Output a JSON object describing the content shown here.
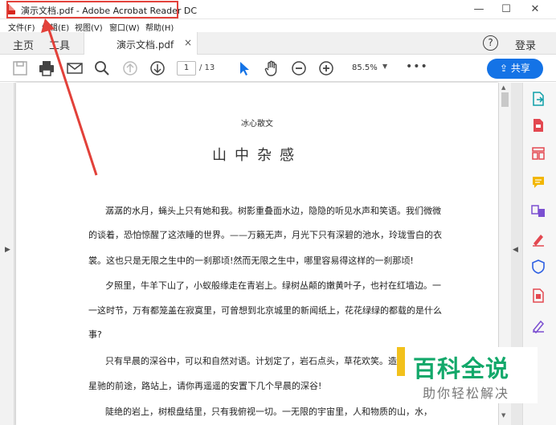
{
  "window": {
    "title": "演示文档.pdf - Adobe Acrobat Reader DC",
    "controls": [
      "—",
      "☐",
      "✕"
    ]
  },
  "menu": [
    "文件(F)",
    "编辑(E)",
    "视图(V)",
    "窗口(W)",
    "帮助(H)"
  ],
  "tabs": {
    "home": "主页",
    "tools": "工具",
    "document": "演示文档.pdf",
    "close": "×",
    "help": "?",
    "login": "登录"
  },
  "toolbar": {
    "page_current": "1",
    "page_total": "/ 13",
    "zoom": "85.5%",
    "more": "•••",
    "share": "共享"
  },
  "document": {
    "subtitle": "冰心散文",
    "title": "山中杂感",
    "lines": [
      "潺潺的水月，蝇头上只有她和我。树影重叠面水边，隐隐的听见水声和笑语。我们微微",
      "的谈着，恐怕惊醒了这浓睡的世界。——万籁无声，月光下只有深碧的池水，玲珑雪白的衣",
      "裳。这也只是无限之生中的一刹那顷!然而无限之生中，哪里容易得这样的一刹那顷!",
      "夕照里，牛羊下山了，小蚁般缘走在青岩上。绿树丛颠的嫩黄叶子，也衬在红墙边。一",
      "一这时节，万有都笼盖在寂寞里，可曾想到北京城里的新闻纸上，花花绿绿的都载的是什么",
      "事?",
      "只有早晨的深谷中，可以和自然对语。计划定了，岩石点头，草花欢笑。造物者",
      "星驰的前途，路站上，请你再遥遥的安置下几个早晨的深谷!",
      "陡绝的岩上，树根盘结里，只有我俯视一切。一无限的宇宙里，人和物质的山，水，"
    ]
  },
  "watermark": {
    "brand": "百科全说",
    "slogan": "助你轻松解决"
  },
  "colors": {
    "accent": "#1473e6",
    "highlight": "#e2413a",
    "watermark_green": "#12a86a"
  }
}
